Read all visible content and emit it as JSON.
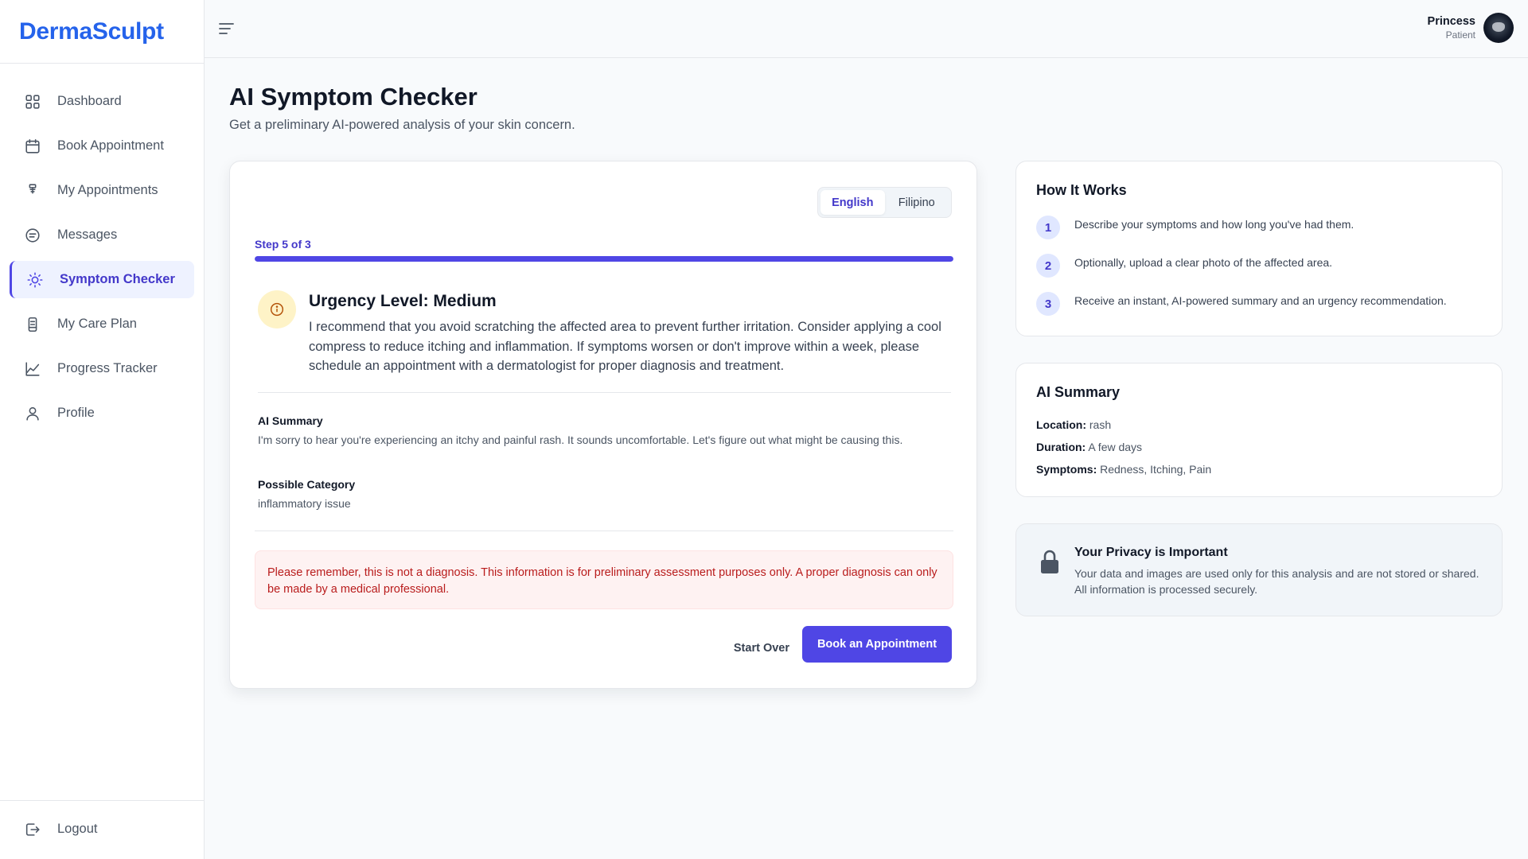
{
  "brand": {
    "name": "DermaSculpt"
  },
  "sidebar": {
    "items": [
      {
        "label": "Dashboard",
        "icon": "grid-icon",
        "active": false
      },
      {
        "label": "Book Appointment",
        "icon": "calendar-icon",
        "active": false
      },
      {
        "label": "My Appointments",
        "icon": "appointment-icon",
        "active": false
      },
      {
        "label": "Messages",
        "icon": "message-icon",
        "active": false
      },
      {
        "label": "Symptom Checker",
        "icon": "sun-icon",
        "active": true
      },
      {
        "label": "My Care Plan",
        "icon": "care-plan-icon",
        "active": false
      },
      {
        "label": "Progress Tracker",
        "icon": "chart-line-icon",
        "active": false
      },
      {
        "label": "Profile",
        "icon": "user-icon",
        "active": false
      }
    ],
    "logout": "Logout"
  },
  "header": {
    "user_name": "Princess",
    "user_role": "Patient"
  },
  "page": {
    "title": "AI Symptom Checker",
    "subtitle": "Get a preliminary AI-powered analysis of your skin concern."
  },
  "checker": {
    "languages": [
      "English",
      "Filipino"
    ],
    "selected_language": "English",
    "step_label": "Step 5 of 3",
    "progress": 1.0,
    "urgency_title": "Urgency Level: Medium",
    "urgency_text": "I recommend that you avoid scratching the affected area to prevent further irritation. Consider applying a cool compress to reduce itching and inflammation. If symptoms worsen or don't improve within a week, please schedule an appointment with a dermatologist for proper diagnosis and treatment.",
    "summary_label": "AI Summary",
    "summary_text": "I'm sorry to hear you're experiencing an itchy and painful rash. It sounds uncomfortable. Let's figure out what might be causing this.",
    "category_label": "Possible Category",
    "category_text": "inflammatory issue",
    "disclaimer": "Please remember, this is not a diagnosis. This information is for preliminary assessment purposes only. A proper diagnosis can only be made by a medical professional.",
    "start_over": "Start Over",
    "book_button": "Book an Appointment"
  },
  "how_it_works": {
    "title": "How It Works",
    "steps": [
      {
        "num": "1",
        "text": "Describe your symptoms and how long you've had them."
      },
      {
        "num": "2",
        "text": "Optionally, upload a clear photo of the affected area."
      },
      {
        "num": "3",
        "text": "Receive an instant, AI-powered summary and an urgency recommendation."
      }
    ]
  },
  "ai_summary": {
    "title": "AI Summary",
    "location_label": "Location:",
    "location_value": "rash",
    "duration_label": "Duration:",
    "duration_value": "A few days",
    "symptoms_label": "Symptoms:",
    "symptoms_value": "Redness, Itching, Pain"
  },
  "privacy": {
    "title": "Your Privacy is Important",
    "text": "Your data and images are used only for this analysis and are not stored or shared. All information is processed securely."
  },
  "colors": {
    "brand": "#2563eb",
    "accent": "#4f46e5",
    "urgency_medium": "#fef3c7",
    "disclaimer_text": "#b91c1c"
  }
}
